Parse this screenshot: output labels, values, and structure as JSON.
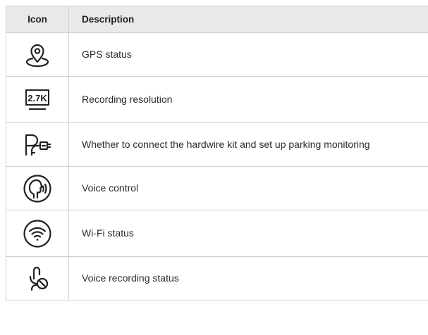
{
  "table": {
    "headers": {
      "icon": "Icon",
      "description": "Description"
    },
    "rows": [
      {
        "icon": "gps-location-pin-icon",
        "description": "GPS status"
      },
      {
        "icon": "resolution-2-7k-icon",
        "icon_text": "2.7K",
        "description": "Recording resolution"
      },
      {
        "icon": "parking-hardwire-kit-icon",
        "description": "Whether to connect the hardwire kit and set up parking monitoring"
      },
      {
        "icon": "voice-control-icon",
        "description": "Voice control"
      },
      {
        "icon": "wifi-icon",
        "description": "Wi-Fi status"
      },
      {
        "icon": "microphone-muted-icon",
        "description": "Voice recording status"
      }
    ]
  }
}
